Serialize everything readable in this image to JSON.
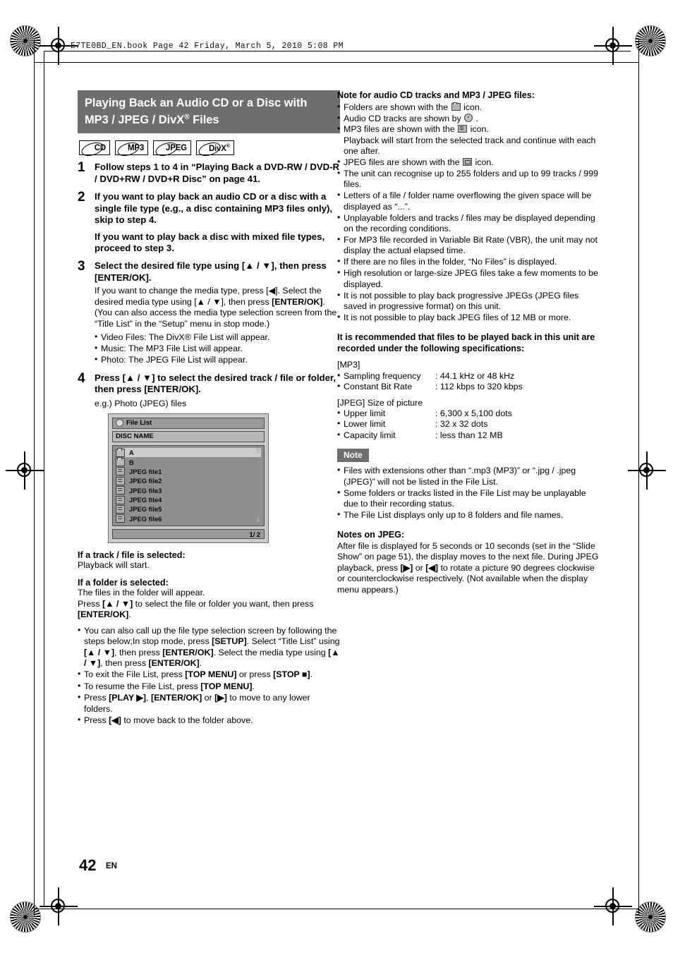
{
  "header": {
    "file_line": "E7TE0BD_EN.book  Page 42  Friday, March 5, 2010  5:08 PM"
  },
  "footer": {
    "page_number": "42",
    "language": "EN"
  },
  "left_column": {
    "title_line1": "Playing Back an Audio CD or a Disc with",
    "title_line2_pre": "MP3 / JPEG / DivX",
    "title_sup": "®",
    "title_line2_post": " Files",
    "badges": [
      {
        "label": "CD",
        "sup": ""
      },
      {
        "label": "MP3",
        "sup": ""
      },
      {
        "label": "JPEG",
        "sup": ""
      },
      {
        "label": "DivX",
        "sup": "®"
      }
    ],
    "steps": [
      {
        "num": "1",
        "lead": "Follow steps 1 to 4 in “Playing Back a DVD-RW / DVD-R / DVD+RW / DVD+R Disc” on page 41."
      },
      {
        "num": "2",
        "lead": "If you want to play back an audio CD or a disc with a single file type (e.g., a disc containing MP3 files only), skip to step 4.",
        "lead2": "If you want to play back a disc with mixed file types, proceed to step 3."
      },
      {
        "num": "3",
        "lead": "Select the desired file type using [▲ / ▼], then press [ENTER/OK].",
        "body_html": "If you want to change the media type, press [◀]. Select the desired media type using [▲ / ▼], then press <b>[ENTER/OK]</b>. (You can also access the media type selection screen from the “Title List” in the “Setup” menu in stop mode.)",
        "bullets": [
          "Video Files: The DivX® File List will appear.",
          "Music: The MP3 File List will appear.",
          "Photo: The JPEG File List will appear."
        ]
      },
      {
        "num": "4",
        "lead": "Press [▲ / ▼] to select the desired track / file or folder, then press [ENTER/OK].",
        "example": "e.g.) Photo (JPEG) files"
      }
    ],
    "file_list_screen": {
      "title": "File List",
      "disc_name": "DISC NAME",
      "items": [
        {
          "name": "A",
          "type": "folder",
          "selected": true
        },
        {
          "name": "B",
          "type": "folder",
          "selected": false
        },
        {
          "name": "JPEG file1",
          "type": "file",
          "selected": false
        },
        {
          "name": "JPEG file2",
          "type": "file",
          "selected": false
        },
        {
          "name": "JPEG file3",
          "type": "file",
          "selected": false
        },
        {
          "name": "JPEG file4",
          "type": "file",
          "selected": false
        },
        {
          "name": "JPEG file5",
          "type": "file",
          "selected": false
        },
        {
          "name": "JPEG file6",
          "type": "file",
          "selected": false
        }
      ],
      "page_indicator": "1/ 2",
      "scroll_up": "⇧",
      "scroll_down": "⇩"
    },
    "track_selected_heading": "If a track / file is selected:",
    "track_selected_text": "Playback will start.",
    "folder_selected_heading": "If a folder is selected:",
    "folder_selected_text1": "The files in the folder will appear.",
    "folder_selected_text2_html": "Press <b>[▲ / ▼]</b> to select the file or folder you want, then press <b>[ENTER/OK]</b>.",
    "bullets_html": [
      "You can also call up the file type selection screen by following the steps below;<span class=\"cont\">In stop mode, press <b>[SETUP]</b>. Select “Title List” using <b>[▲ / ▼]</b>, then press <b>[ENTER/OK]</b>. Select the media type using <b>[▲ / ▼]</b>, then press <b>[ENTER/OK]</b>.</span>",
      "To exit the File List, press <b>[TOP MENU]</b> or press <b>[STOP ■]</b>.",
      "To resume the File List, press <b>[TOP MENU]</b>.",
      "Press <b>[PLAY ▶]</b>, <b>[ENTER/OK]</b> or <b>[▶]</b> to move to any lower folders.",
      "Press <b>[◀]</b> to move back to the folder above."
    ]
  },
  "right_column": {
    "note_heading": "Note for audio CD tracks and MP3 / JPEG files:",
    "note_bullets_html": [
      "Folders are shown with the <span class=\"iconinline folder\"></span> icon.",
      "Audio CD tracks are shown by <span class=\"iconinline disc\"></span> .",
      "MP3 files are shown with the <span class=\"iconinline note\"></span> icon.<span class=\"cont\">Playback will start from the selected track and continue with each one after.</span>",
      "JPEG files are shown with the <span class=\"iconinline pic\"></span> icon.",
      "The unit can recognise up to 255 folders and up to 99 tracks / 999 files.",
      "Letters of a file / folder name overflowing the given space will be displayed as “...”.",
      "Unplayable folders and tracks / files may be displayed depending on the recording conditions.",
      "For MP3 file recorded in Variable Bit Rate (VBR), the unit may not display the actual elapsed time.",
      "If there are no files in the folder, “No Files” is displayed.",
      "High resolution or large-size JPEG files take a few moments to be displayed.",
      "It is not possible to play back progressive JPEGs (JPEG files saved in progressive format) on this unit.",
      "It is not possible to play back JPEG files of 12 MB or more."
    ],
    "recommend_heading": "It is recommended that files to be played back in this unit are recorded under the following specifications:",
    "spec_groups": [
      {
        "group": "[MP3]",
        "rows": [
          {
            "key": "Sampling frequency",
            "value": ": 44.1 kHz or 48 kHz"
          },
          {
            "key": "Constant Bit Rate",
            "value": ": 112 kbps to 320 kbps"
          }
        ]
      },
      {
        "group": "[JPEG] Size of picture",
        "rows": [
          {
            "key": "Upper limit",
            "value": ": 6,300 x 5,100 dots"
          },
          {
            "key": "Lower limit",
            "value": ": 32 x 32 dots"
          },
          {
            "key": "Capacity limit",
            "value": ": less than 12 MB"
          }
        ]
      }
    ],
    "note_badge": "Note",
    "note_box_bullets": [
      "Files with extensions other than “.mp3 (MP3)” or “.jpg / .jpeg (JPEG)” will not be listed in the File List.",
      "Some folders or tracks listed in the File List may be unplayable due to their recording status.",
      "The File List displays only up to 8 folders and file names."
    ],
    "jpeg_notes_heading": "Notes on JPEG:",
    "jpeg_notes_text_html": "After file is displayed for 5 seconds or 10 seconds (set in the “Slide Show” on page 51), the display moves to the next file. During JPEG playback, press <b>[▶]</b> or <b>[◀]</b> to rotate a picture 90 degrees clockwise or counterclockwise respectively. (Not available when the display menu appears.)"
  }
}
